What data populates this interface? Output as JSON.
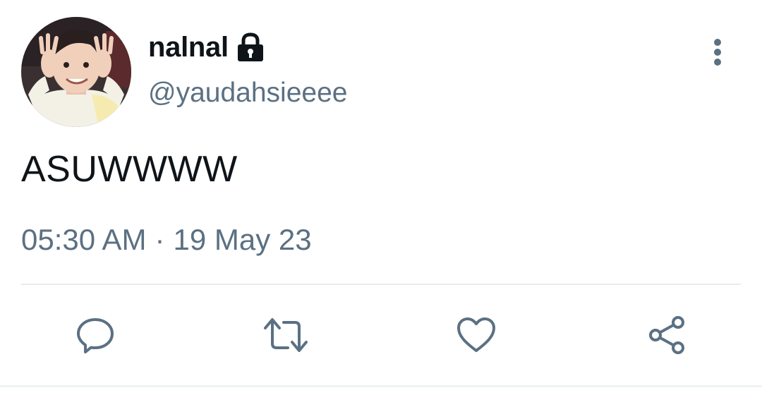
{
  "user": {
    "display_name": "nalnal",
    "handle": "@yaudahsieeee",
    "protected_icon": "lock-icon",
    "avatar_icon": "avatar"
  },
  "tweet": {
    "text": "ASUWWWW",
    "time": "05:30 AM",
    "separator": "·",
    "date": "19 May 23"
  },
  "actions": {
    "reply": "reply-icon",
    "retweet": "retweet-icon",
    "like": "heart-icon",
    "share": "share-icon",
    "more": "more-vertical-icon"
  },
  "colors": {
    "text_primary": "#0f1419",
    "text_secondary": "#5b7083",
    "icon": "#5b7083",
    "divider": "#e6ecf0"
  }
}
